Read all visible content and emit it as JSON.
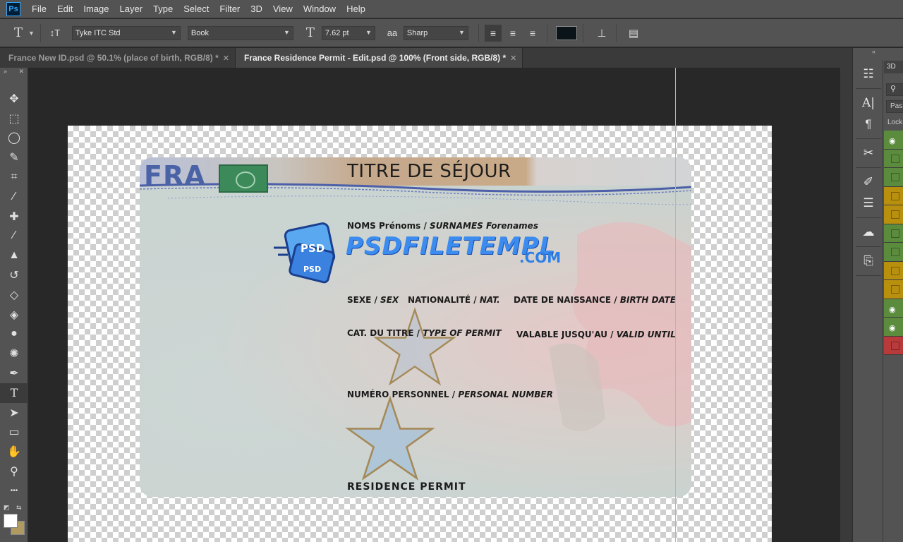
{
  "app": {
    "logo": "Ps"
  },
  "menu": [
    "File",
    "Edit",
    "Image",
    "Layer",
    "Type",
    "Select",
    "Filter",
    "3D",
    "View",
    "Window",
    "Help"
  ],
  "options": {
    "tool_icon": "T",
    "orient_icon": "↕T",
    "font_family": "Tyke ITC Std",
    "font_style": "Book",
    "size_icon": "T",
    "font_size": "7.62 pt",
    "aa_icon": "aa",
    "antialias": "Sharp",
    "text_color": "#0b1418"
  },
  "tabs": [
    {
      "label": "France New ID.psd @ 50.1% (place of birth, RGB/8) *",
      "close": "✕",
      "active": false
    },
    {
      "label": "France Residence Permit - Edit.psd @ 100% (Front side, RGB/8) *",
      "close": "✕",
      "active": true
    }
  ],
  "toolbar": {
    "collapse": "»",
    "close": "✕",
    "tools": [
      {
        "name": "move-tool",
        "glyph": "✥"
      },
      {
        "name": "marquee-tool",
        "glyph": "⬚"
      },
      {
        "name": "lasso-tool",
        "glyph": "◯"
      },
      {
        "name": "quick-select-tool",
        "glyph": "✎"
      },
      {
        "name": "crop-tool",
        "glyph": "⌗"
      },
      {
        "name": "eyedropper-tool",
        "glyph": "⁄"
      },
      {
        "name": "healing-brush-tool",
        "glyph": "✚"
      },
      {
        "name": "brush-tool",
        "glyph": "∕"
      },
      {
        "name": "clone-stamp-tool",
        "glyph": "▲"
      },
      {
        "name": "history-brush-tool",
        "glyph": "↺"
      },
      {
        "name": "eraser-tool",
        "glyph": "◇"
      },
      {
        "name": "paint-bucket-tool",
        "glyph": "◈"
      },
      {
        "name": "blur-tool",
        "glyph": "●"
      },
      {
        "name": "dodge-tool",
        "glyph": "✺"
      },
      {
        "name": "pen-tool",
        "glyph": "✒"
      },
      {
        "name": "type-tool",
        "glyph": "T"
      },
      {
        "name": "path-select-tool",
        "glyph": "➤"
      },
      {
        "name": "rectangle-tool",
        "glyph": "▭"
      },
      {
        "name": "hand-tool",
        "glyph": "✋"
      },
      {
        "name": "zoom-tool",
        "glyph": "⚲"
      },
      {
        "name": "more-tools",
        "glyph": "•••"
      }
    ],
    "fg_color": "#ffffff",
    "bg_color": "#b09a60"
  },
  "card": {
    "country": "FRA",
    "title": "TITRE DE SÉJOUR",
    "names_fr": "NOMS Prénoms /",
    "names_en": "SURNAMES Forenames",
    "sex_fr": "SEXE /",
    "sex_en": "SEX",
    "nat_fr": "NATIONALITÉ /",
    "nat_en": "NAT.",
    "dob_fr": "DATE DE NAISSANCE /",
    "dob_en": "BIRTH DATE",
    "cat_fr": "CAT. DU TITRE /",
    "cat_en": "TYPE OF PERMIT",
    "valid_fr": "VALABLE JUSQU'AU /",
    "valid_en": "VALID UNTIL",
    "num_fr": "NUMÉRO PERSONNEL /",
    "num_en": "PERSONAL NUMBER",
    "footer": "RESIDENCE PERMIT"
  },
  "watermark": {
    "badge": "PSD",
    "badge2": "PSD",
    "text": "PSDFILETEMPL",
    "com": ".COM"
  },
  "right_panel": {
    "collapse": "«",
    "tab": "3D",
    "search_icon": "⚲",
    "pass": "Pas",
    "lock": "Lock",
    "layers": [
      {
        "color": "#5b8c3e",
        "visible": true
      },
      {
        "color": "#5b8c3e",
        "visible": false
      },
      {
        "color": "#5b8c3e",
        "visible": false
      },
      {
        "color": "#b8900e",
        "visible": false
      },
      {
        "color": "#b8900e",
        "visible": false
      },
      {
        "color": "#5b8c3e",
        "visible": false
      },
      {
        "color": "#5b8c3e",
        "visible": false
      },
      {
        "color": "#b8900e",
        "visible": false
      },
      {
        "color": "#b8900e",
        "visible": false
      },
      {
        "color": "#5b8c3e",
        "visible": true
      },
      {
        "color": "#5b8c3e",
        "visible": true
      },
      {
        "color": "#b83a3a",
        "visible": false
      }
    ]
  }
}
